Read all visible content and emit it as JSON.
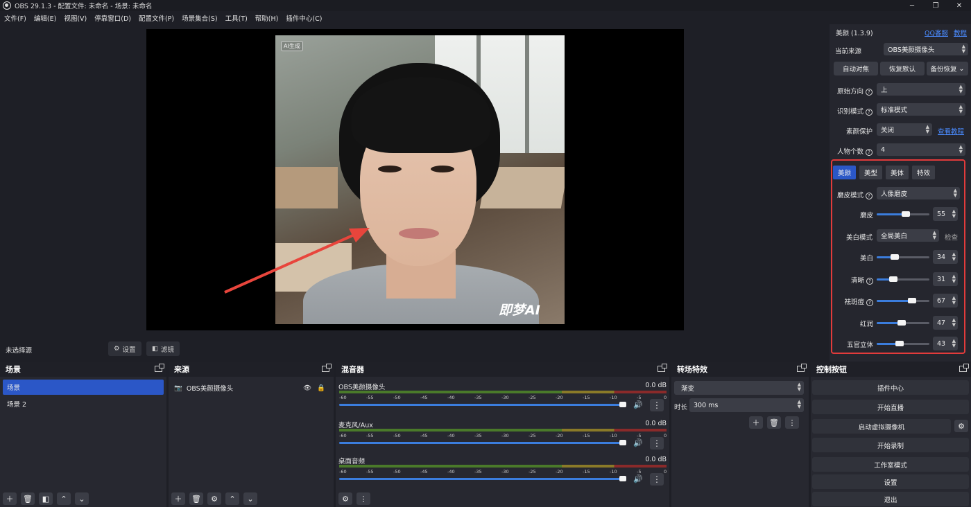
{
  "window": {
    "title": "OBS 29.1.3 - 配置文件: 未命名 - 场景: 未命名"
  },
  "menu": [
    "文件(F)",
    "编辑(E)",
    "视图(V)",
    "停靠窗口(D)",
    "配置文件(P)",
    "场景集合(S)",
    "工具(T)",
    "帮助(H)",
    "插件中心(C)"
  ],
  "preview": {
    "ai_tag": "AI生成",
    "watermark": "即梦AI"
  },
  "beauty": {
    "title": "美颜 (1.3.9)",
    "qq_link": "QQ客服",
    "tutorial_link": "教程",
    "current_source_label": "当前来源",
    "current_source_value": "OBS美颜摄像头",
    "auto_focus": "自动对焦",
    "restore_default": "恢复默认",
    "backup_restore": "备份恢复",
    "orientation_label": "原始方向",
    "orientation_value": "上",
    "recognition_label": "识别模式",
    "recognition_value": "标准模式",
    "plain_protect_label": "素颜保护",
    "plain_protect_value": "关闭",
    "view_tutorial": "查看教程",
    "people_label": "人物个数",
    "people_value": "4",
    "tabs": [
      "美颜",
      "美型",
      "美体",
      "特效"
    ],
    "smooth_mode_label": "磨皮模式",
    "smooth_mode_value": "人像磨皮",
    "whiten_mode_label": "美白模式",
    "whiten_mode_value": "全局美白",
    "check_label": "检查",
    "sliders": [
      {
        "label": "磨皮",
        "value": 55,
        "help": false
      },
      {
        "label": "美白",
        "value": 34,
        "help": false
      },
      {
        "label": "清晰",
        "value": 31,
        "help": true
      },
      {
        "label": "祛斑痘",
        "value": 67,
        "help": true
      },
      {
        "label": "红润",
        "value": 47,
        "help": false
      },
      {
        "label": "五官立体",
        "value": 43,
        "help": false
      }
    ]
  },
  "source_bar": {
    "no_source": "未选择源",
    "settings": "设置",
    "filters": "滤镜"
  },
  "scenes": {
    "title": "场景",
    "items": [
      "场景",
      "场景 2"
    ]
  },
  "sources": {
    "title": "来源",
    "items": [
      "OBS美颜摄像头"
    ]
  },
  "mixer": {
    "title": "混音器",
    "channels": [
      {
        "name": "OBS美颜摄像头",
        "db": "0.0 dB"
      },
      {
        "name": "麦克风/Aux",
        "db": "0.0 dB"
      },
      {
        "name": "桌面音频",
        "db": "0.0 dB"
      }
    ],
    "ticks": [
      "-60",
      "-55",
      "-50",
      "-45",
      "-40",
      "-35",
      "-30",
      "-25",
      "-20",
      "-15",
      "-10",
      "-5",
      "0"
    ]
  },
  "transitions": {
    "title": "转场特效",
    "type": "渐变",
    "duration_label": "时长",
    "duration_value": "300 ms"
  },
  "controls": {
    "title": "控制按钮",
    "buttons": [
      "插件中心",
      "开始直播",
      "启动虚拟摄像机",
      "开始录制",
      "工作室模式",
      "设置",
      "退出"
    ]
  },
  "colors": {
    "accent": "#2b57c7",
    "highlight_box": "#e23b3b",
    "arrow": "#e8453c"
  }
}
